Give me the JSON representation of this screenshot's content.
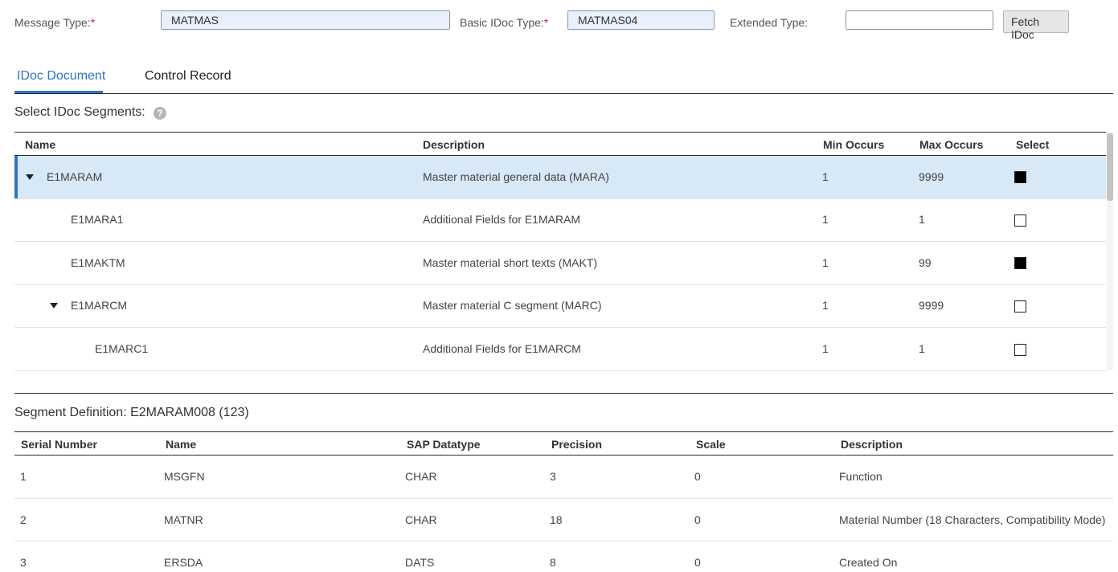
{
  "header": {
    "message_type_label": "Message Type:",
    "message_type_value": "MATMAS",
    "basic_type_label": "Basic IDoc Type:",
    "basic_type_value": "MATMAS04",
    "required_mark": "*",
    "extended_type_label": "Extended Type:",
    "extended_type_value": "",
    "fetch_button": "Fetch IDoc"
  },
  "tabs": [
    {
      "label": "IDoc Document",
      "active": true
    },
    {
      "label": "Control Record",
      "active": false
    }
  ],
  "segments": {
    "title": "Select IDoc Segments:",
    "help_glyph": "?",
    "columns": [
      "Name",
      "Description",
      "Min Occurs",
      "Max Occurs",
      "Select"
    ],
    "rows": [
      {
        "name": "E1MARAM",
        "description": "Master material general data (MARA)",
        "min": "1",
        "max": "9999",
        "selected": true,
        "expandable": true,
        "highlighted": true
      },
      {
        "name": "E1MARA1",
        "description": "Additional Fields for E1MARAM",
        "min": "1",
        "max": "1",
        "selected": false,
        "expandable": false,
        "highlighted": false
      },
      {
        "name": "E1MAKTM",
        "description": "Master material short texts (MAKT)",
        "min": "1",
        "max": "99",
        "selected": true,
        "expandable": false,
        "highlighted": false
      },
      {
        "name": "E1MARCM",
        "description": "Master material C segment (MARC)",
        "min": "1",
        "max": "9999",
        "selected": false,
        "expandable": true,
        "highlighted": false
      },
      {
        "name": "E1MARC1",
        "description": "Additional Fields for E1MARCM",
        "min": "1",
        "max": "1",
        "selected": false,
        "expandable": false,
        "highlighted": false
      }
    ]
  },
  "definition": {
    "title": "Segment Definition: E2MARAM008 (123)",
    "columns": [
      "Serial Number",
      "Name",
      "SAP Datatype",
      "Precision",
      "Scale",
      "Description"
    ],
    "rows": [
      {
        "serial": "1",
        "name": "MSGFN",
        "datatype": "CHAR",
        "precision": "3",
        "scale": "0",
        "description": "Function"
      },
      {
        "serial": "2",
        "name": "MATNR",
        "datatype": "CHAR",
        "precision": "18",
        "scale": "0",
        "description": "Material Number (18 Characters, Compatibility Mode)"
      },
      {
        "serial": "3",
        "name": "ERSDA",
        "datatype": "DATS",
        "precision": "8",
        "scale": "0",
        "description": "Created On"
      }
    ]
  },
  "colors": {
    "accent": "#2f73c7",
    "selected_row": "#d7e8f7",
    "required": "#d9232e"
  }
}
